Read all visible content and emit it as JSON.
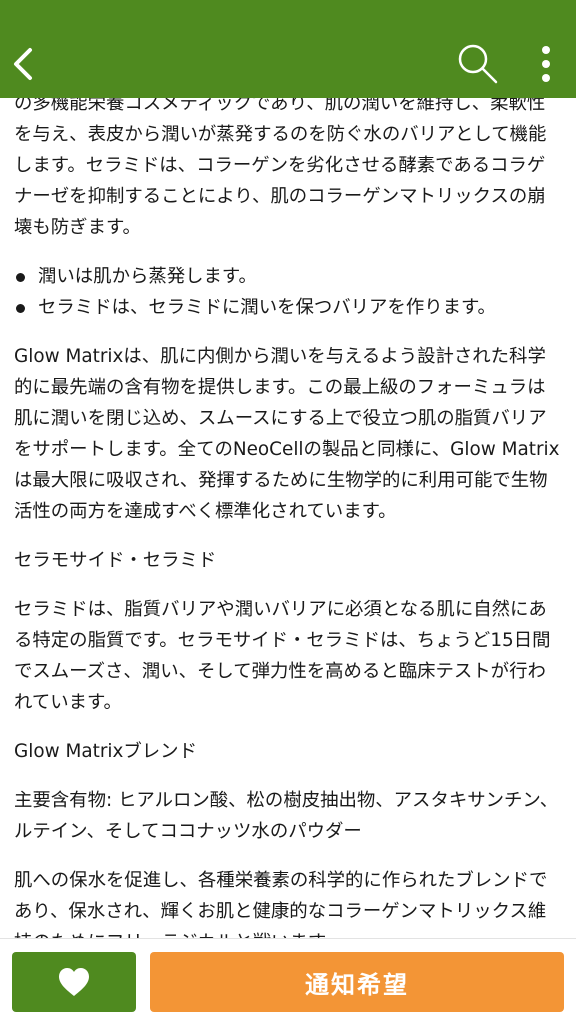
{
  "colors": {
    "header_bg": "#4f8a1f",
    "favorite_bg": "#4f8a1f",
    "notify_bg": "#f39536",
    "text": "#1a1a1a"
  },
  "header": {
    "back_icon": "chevron-left-icon",
    "search_icon": "search-icon",
    "more_icon": "more-vertical-icon"
  },
  "content": {
    "intro": "の多機能栄養コスメティックであり、肌の潤いを維持し、柔軟性を与え、表皮から潤いが蒸発するのを防ぐ水のバリアとして機能します。セラミドは、コラーゲンを劣化させる酵素であるコラゲナーゼを抑制することにより、肌のコラーゲンマトリックスの崩壊も防ぎます。",
    "bullets": [
      "潤いは肌から蒸発します。",
      "セラミドは、セラミドに潤いを保つバリアを作ります。"
    ],
    "glow_matrix_para": "Glow Matrixは、肌に内側から潤いを与えるよう設計された科学的に最先端の含有物を提供します。この最上級のフォーミュラは肌に潤いを閉じ込め、スムースにする上で役立つ肌の脂質バリアをサポートします。全てのNeoCellの製品と同様に、Glow Matrixは最大限に吸収され、発揮するために生物学的に利用可能で生物活性の両方を達成すべく標準化されています。",
    "ceramide_heading": "セラモサイド・セラミド",
    "ceramide_para": "セラミドは、脂質バリアや潤いバリアに必須となる肌に自然にある特定の脂質です。セラモサイド・セラミドは、ちょうど15日間でスムーズさ、潤い、そして弾力性を高めると臨床テストが行われています。",
    "blend_heading": "Glow Matrixブレンド",
    "ingredients": "主要含有物: ヒアルロン酸、松の樹皮抽出物、アスタキサンチン、ルテイン、そしてココナッツ水のパウダー",
    "blend_para": "肌への保水を促進し、各種栄養素の科学的に作られたブレンドであり、保水され、輝くお肌と健康的なコラーゲンマトリックス維持のためにフリーラジカルと戦います。"
  },
  "footer": {
    "favorite_icon": "heart-icon",
    "notify_label": "通知希望"
  }
}
